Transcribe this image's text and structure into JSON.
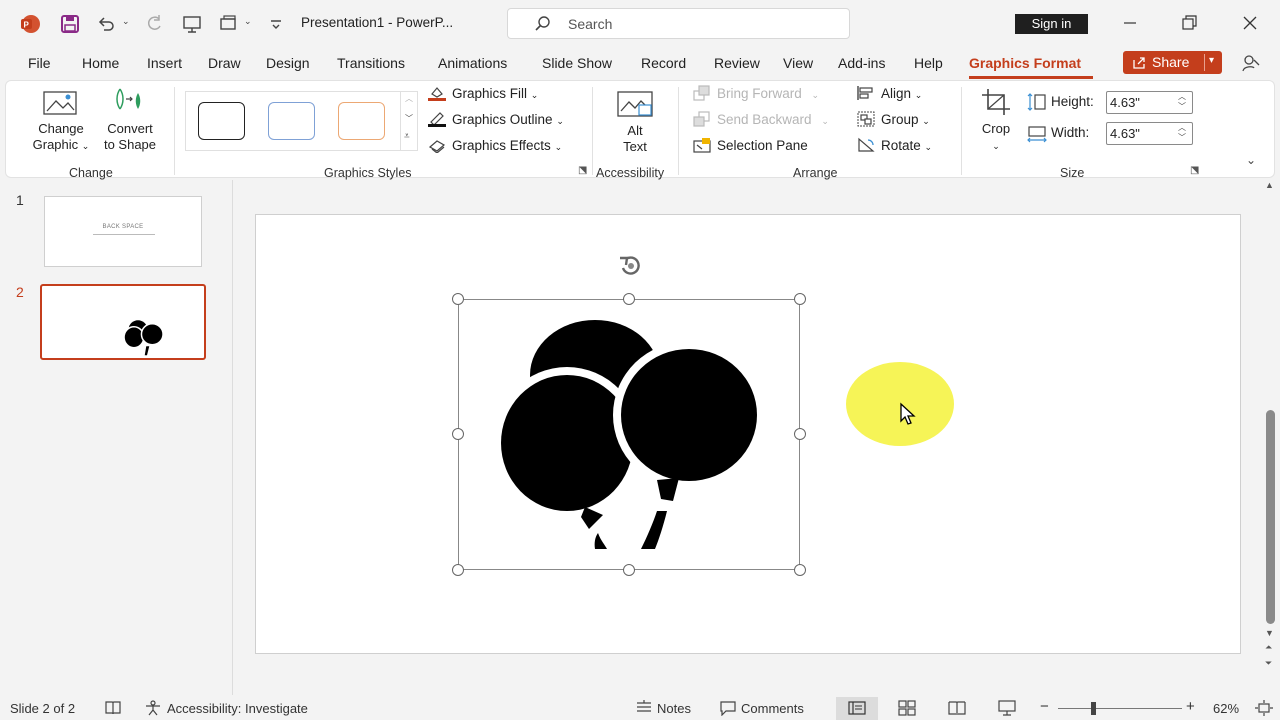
{
  "title_bar": {
    "doc_title": "Presentation1  -  PowerP...",
    "search_placeholder": "Search",
    "sign_in": "Sign in"
  },
  "tabs": [
    "File",
    "Home",
    "Insert",
    "Draw",
    "Design",
    "Transitions",
    "Animations",
    "Slide Show",
    "Record",
    "Review",
    "View",
    "Add-ins",
    "Help",
    "Graphics Format"
  ],
  "active_tab": "Graphics Format",
  "share_label": "Share",
  "colors": {
    "accent": "#c43e1c",
    "style_gray": "#222222",
    "style_blue": "#7fa1d6",
    "style_orange": "#eca874",
    "highlight": "#f4f23a"
  },
  "ribbon": {
    "change_graphic": {
      "line1": "Change",
      "line2": "Graphic"
    },
    "convert_shape": {
      "line1": "Convert",
      "line2": "to Shape"
    },
    "group_change": "Change",
    "graphics_fill": "Graphics Fill",
    "graphics_outline": "Graphics Outline",
    "graphics_effects": "Graphics Effects",
    "group_styles": "Graphics Styles",
    "alt_text": {
      "line1": "Alt",
      "line2": "Text"
    },
    "group_accessibility": "Accessibility",
    "bring_forward": "Bring Forward",
    "send_backward": "Send Backward",
    "selection_pane": "Selection Pane",
    "align": "Align",
    "group": "Group",
    "rotate": "Rotate",
    "group_arrange": "Arrange",
    "crop": "Crop",
    "height_label": "Height:",
    "height_value": "4.63\"",
    "width_label": "Width:",
    "width_value": "4.63\"",
    "group_size": "Size"
  },
  "slides": [
    {
      "number": "1",
      "title_text": "BACK SPACE"
    },
    {
      "number": "2"
    }
  ],
  "status": {
    "slide_info": "Slide 2 of 2",
    "accessibility": "Accessibility: Investigate",
    "notes": "Notes",
    "comments": "Comments",
    "zoom": "62%"
  }
}
